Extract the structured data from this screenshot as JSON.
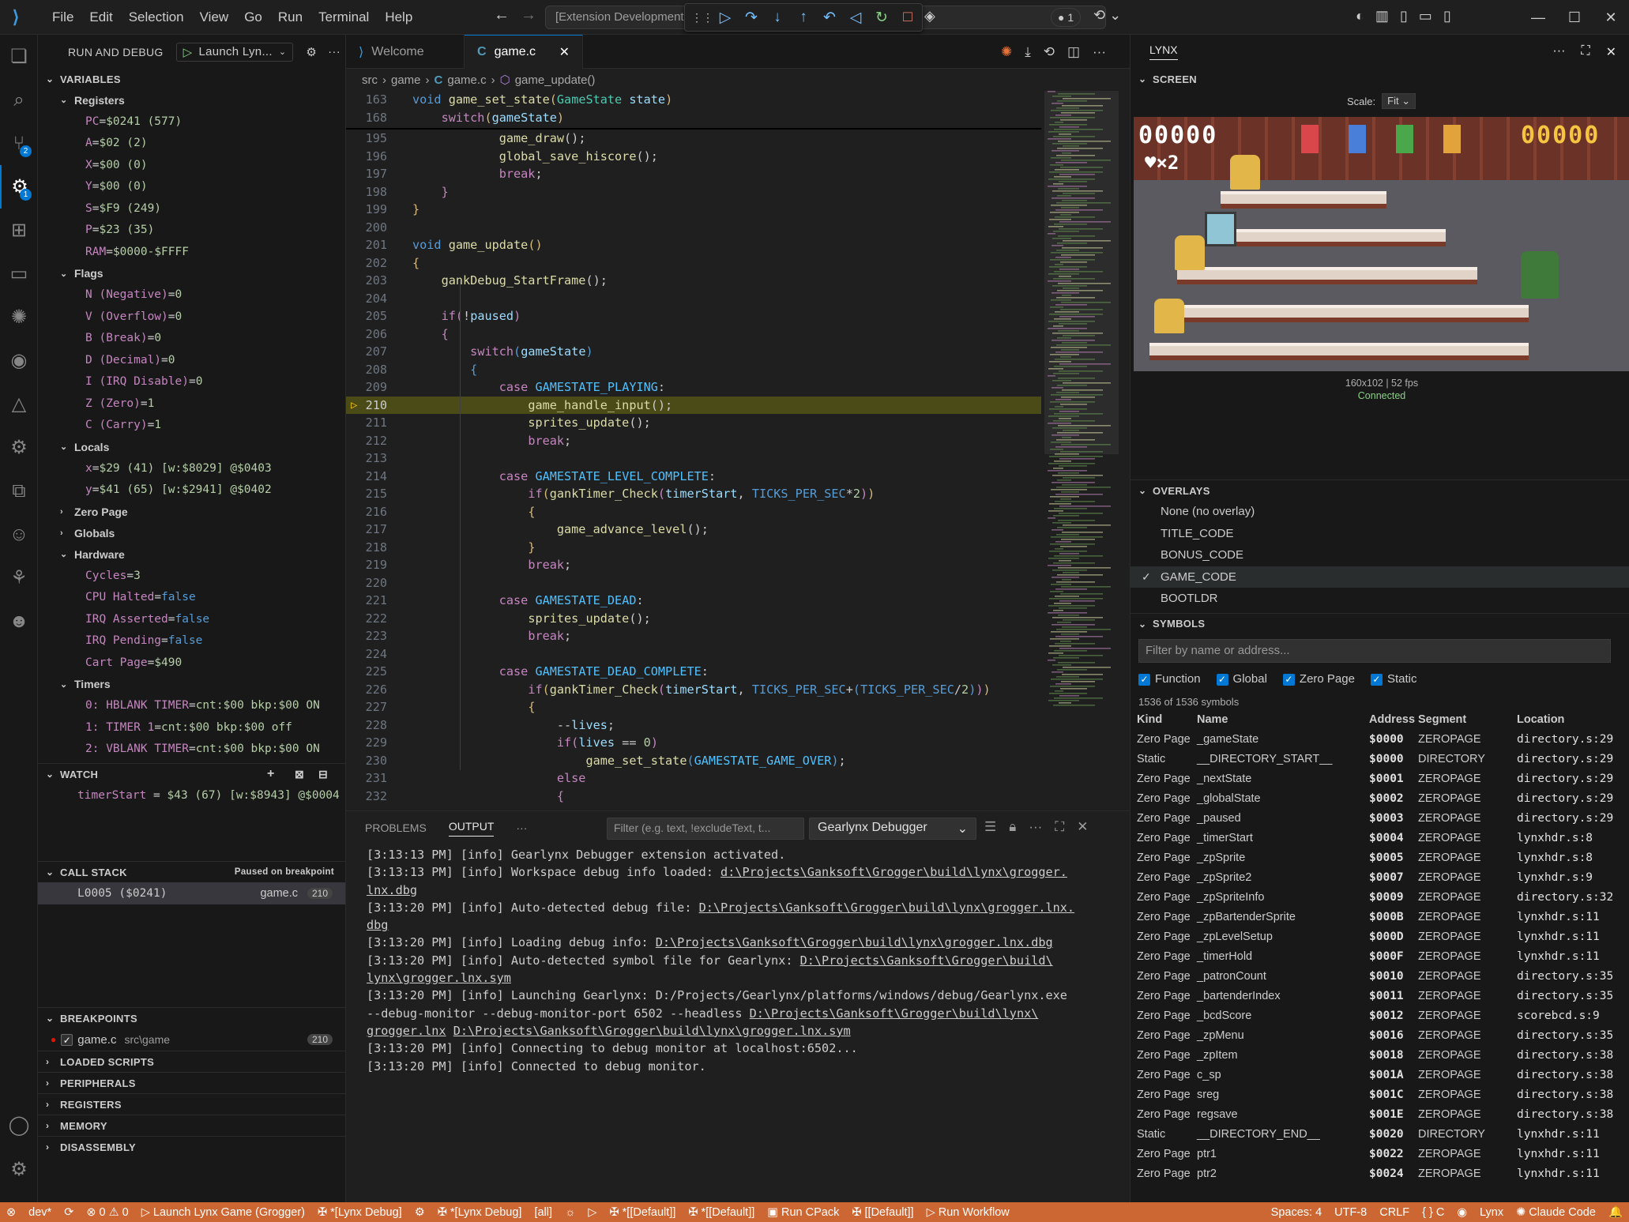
{
  "titlebar": {
    "menu": [
      "File",
      "Edit",
      "Selection",
      "View",
      "Go",
      "Run",
      "Terminal",
      "Help"
    ],
    "search": "[Extension Development",
    "debug_count": "1",
    "debug_actions": [
      "continue-icon",
      "step-over-icon",
      "step-into-icon",
      "step-out-icon",
      "step-back-icon",
      "reverse-continue-icon",
      "restart-icon",
      "stop-icon"
    ]
  },
  "activity": [
    {
      "name": "explorer-icon",
      "glyph": "❏"
    },
    {
      "name": "search-icon",
      "glyph": "⌕"
    },
    {
      "name": "source-control-icon",
      "glyph": "⑂",
      "badge": "2"
    },
    {
      "name": "run-debug-icon",
      "glyph": "⚙",
      "badge": "1"
    },
    {
      "name": "extensions-icon",
      "glyph": "⊞"
    },
    {
      "name": "remote-explorer-icon",
      "glyph": "▭"
    },
    {
      "name": "claude-icon",
      "glyph": "✺"
    },
    {
      "name": "github-icon",
      "glyph": "◉"
    },
    {
      "name": "azure-icon",
      "glyph": "△"
    },
    {
      "name": "remote-debug-icon",
      "glyph": "⚙"
    },
    {
      "name": "structure-icon",
      "glyph": "⧉"
    },
    {
      "name": "bot-icon",
      "glyph": "☺"
    },
    {
      "name": "tree-icon",
      "glyph": "⚘"
    },
    {
      "name": "alien-icon",
      "glyph": "☻"
    }
  ],
  "sidebar": {
    "title": "RUN AND DEBUG",
    "launch": "Launch Lyn...",
    "variables": "VARIABLES",
    "registers_title": "Registers",
    "registers": [
      {
        "n": "PC",
        "v": "$0241 (577)"
      },
      {
        "n": "A",
        "v": "$02 (2)"
      },
      {
        "n": "X",
        "v": "$00 (0)"
      },
      {
        "n": "Y",
        "v": "$00 (0)"
      },
      {
        "n": "S",
        "v": "$F9 (249)"
      },
      {
        "n": "P",
        "v": "$23 (35)"
      },
      {
        "n": "RAM",
        "v": "$0000-$FFFF"
      }
    ],
    "flags_title": "Flags",
    "flags": [
      {
        "n": "N (Negative)",
        "v": "0"
      },
      {
        "n": "V (Overflow)",
        "v": "0"
      },
      {
        "n": "B (Break)",
        "v": "0"
      },
      {
        "n": "D (Decimal)",
        "v": "0"
      },
      {
        "n": "I (IRQ Disable)",
        "v": "0"
      },
      {
        "n": "Z (Zero)",
        "v": "1"
      },
      {
        "n": "C (Carry)",
        "v": "1"
      }
    ],
    "locals_title": "Locals",
    "locals": [
      {
        "n": "x",
        "v": "$29 (41) [w:$8029] @$0403"
      },
      {
        "n": "y",
        "v": "$41 (65) [w:$2941] @$0402"
      }
    ],
    "zero_page": "Zero Page",
    "globals": "Globals",
    "hardware_title": "Hardware",
    "hardware": [
      {
        "n": "Cycles",
        "v": "3",
        "bool": false
      },
      {
        "n": "CPU Halted",
        "v": "false",
        "bool": true
      },
      {
        "n": "IRQ Asserted",
        "v": "false",
        "bool": true
      },
      {
        "n": "IRQ Pending",
        "v": "false",
        "bool": true
      },
      {
        "n": "Cart Page",
        "v": "$490",
        "bool": false
      }
    ],
    "timers_title": "Timers",
    "timers": [
      {
        "n": "0: HBLANK TIMER",
        "v": "cnt:$00 bkp:$00 ON"
      },
      {
        "n": "1: TIMER 1",
        "v": "cnt:$00 bkp:$00 off"
      },
      {
        "n": "2: VBLANK TIMER",
        "v": "cnt:$00 bkp:$00 ON"
      }
    ],
    "watch": "WATCH",
    "watch_expr": {
      "n": "timerStart",
      "v": "$43 (67) [w:$8943] @$0004"
    },
    "callstack": "CALL STACK",
    "paused": "Paused on breakpoint",
    "frame": {
      "name": "L0005 ($0241)",
      "file": "game.c",
      "line": "210"
    },
    "breakpoints": "BREAKPOINTS",
    "bp": {
      "file": "game.c",
      "path": "src\\game",
      "line": "210"
    },
    "collapsed": [
      "LOADED SCRIPTS",
      "PERIPHERALS",
      "REGISTERS",
      "MEMORY",
      "DISASSEMBLY"
    ]
  },
  "editor": {
    "tabs": [
      "Welcome",
      "game.c"
    ],
    "breadcrumb": [
      "src",
      "game",
      "game.c",
      "game_update()"
    ],
    "sticky": [
      {
        "ln": "163",
        "html": "<span class='kw'>void</span> <span class='fn'>game_set_state</span><span class='br'>(</span><span class='ty'>GameState</span> <span class='id'>state</span><span class='br'>)</span>"
      },
      {
        "ln": "168",
        "html": "    <span class='ctl'>switch</span><span class='br'>(</span><span class='id'>gameState</span><span class='br'>)</span>"
      }
    ],
    "lines": [
      {
        "ln": "195",
        "html": "            <span class='fn'>game_draw</span><span class='pl'>();</span>"
      },
      {
        "ln": "196",
        "html": "            <span class='fn'>global_save_hiscore</span><span class='pl'>();</span>"
      },
      {
        "ln": "197",
        "html": "            <span class='ctl'>break</span><span class='pl'>;</span>"
      },
      {
        "ln": "198",
        "html": "    <span class='ctl'>}</span>"
      },
      {
        "ln": "199",
        "html": "<span class='br'>}</span>"
      },
      {
        "ln": "200",
        "html": ""
      },
      {
        "ln": "201",
        "html": "<span class='kw'>void</span> <span class='fn'>game_update</span><span class='br'>()</span>"
      },
      {
        "ln": "202",
        "html": "<span class='br'>{</span>"
      },
      {
        "ln": "203",
        "html": "    <span class='fn'>gankDebug_StartFrame</span><span class='pl'>();</span>"
      },
      {
        "ln": "204",
        "html": ""
      },
      {
        "ln": "205",
        "html": "    <span class='ctl'>if</span><span class='ctl'>(</span><span class='pl'>!</span><span class='id'>paused</span><span class='ctl'>)</span>"
      },
      {
        "ln": "206",
        "html": "    <span class='ctl'>{</span>"
      },
      {
        "ln": "207",
        "html": "        <span class='ctl'>switch</span><span class='kw'>(</span><span class='id'>gameState</span><span class='kw'>)</span>"
      },
      {
        "ln": "208",
        "html": "        <span class='kw'>{</span>"
      },
      {
        "ln": "209",
        "html": "            <span class='ctl'>case</span> <span class='ct'>GAMESTATE_PLAYING</span><span class='pl'>:</span>"
      },
      {
        "ln": "210",
        "html": "                <span class='fn'>game_handle_input</span><span class='pl'>();</span>",
        "hl": true
      },
      {
        "ln": "211",
        "html": "                <span class='fn'>sprites_update</span><span class='pl'>();</span>"
      },
      {
        "ln": "212",
        "html": "                <span class='ctl'>break</span><span class='pl'>;</span>"
      },
      {
        "ln": "213",
        "html": ""
      },
      {
        "ln": "214",
        "html": "            <span class='ctl'>case</span> <span class='ct'>GAMESTATE_LEVEL_COMPLETE</span><span class='pl'>:</span>"
      },
      {
        "ln": "215",
        "html": "                <span class='ctl'>if</span><span class='br'>(</span><span class='fn'>gankTimer_Check</span><span class='ctl'>(</span><span class='id'>timerStart</span><span class='pl'>, </span><span class='mac'>TICKS_PER_SEC</span><span class='pl'>*</span><span class='nm'>2</span><span class='ctl'>)</span><span class='br'>)</span>"
      },
      {
        "ln": "216",
        "html": "                <span class='br'>{</span>"
      },
      {
        "ln": "217",
        "html": "                    <span class='fn'>game_advance_level</span><span class='pl'>();</span>"
      },
      {
        "ln": "218",
        "html": "                <span class='br'>}</span>"
      },
      {
        "ln": "219",
        "html": "                <span class='ctl'>break</span><span class='pl'>;</span>"
      },
      {
        "ln": "220",
        "html": ""
      },
      {
        "ln": "221",
        "html": "            <span class='ctl'>case</span> <span class='ct'>GAMESTATE_DEAD</span><span class='pl'>:</span>"
      },
      {
        "ln": "222",
        "html": "                <span class='fn'>sprites_update</span><span class='pl'>();</span>"
      },
      {
        "ln": "223",
        "html": "                <span class='ctl'>break</span><span class='pl'>;</span>"
      },
      {
        "ln": "224",
        "html": ""
      },
      {
        "ln": "225",
        "html": "            <span class='ctl'>case</span> <span class='ct'>GAMESTATE_DEAD_COMPLETE</span><span class='pl'>:</span>"
      },
      {
        "ln": "226",
        "html": "                <span class='ctl'>if</span><span class='br'>(</span><span class='fn'>gankTimer_Check</span><span class='ctl'>(</span><span class='id'>timerStart</span><span class='pl'>, </span><span class='mac'>TICKS_PER_SEC</span><span class='pl'>+</span><span class='kw'>(</span><span class='mac'>TICKS_PER_SEC</span><span class='pl'>/</span><span class='nm'>2</span><span class='kw'>)</span><span class='ctl'>)</span><span class='br'>)</span>"
      },
      {
        "ln": "227",
        "html": "                <span class='br'>{</span>"
      },
      {
        "ln": "228",
        "html": "                    <span class='pl'>--</span><span class='id'>lives</span><span class='pl'>;</span>"
      },
      {
        "ln": "229",
        "html": "                    <span class='ctl'>if</span><span class='ctl'>(</span><span class='id'>lives</span> <span class='pl'>==</span> <span class='nm'>0</span><span class='ctl'>)</span>"
      },
      {
        "ln": "230",
        "html": "                        <span class='fn'>game_set_state</span><span class='kw'>(</span><span class='ct'>GAMESTATE_GAME_OVER</span><span class='kw'>)</span><span class='pl'>;</span>"
      },
      {
        "ln": "231",
        "html": "                    <span class='ctl'>else</span>"
      },
      {
        "ln": "232",
        "html": "                    <span class='ctl'>{</span>"
      }
    ]
  },
  "panel": {
    "tabs": [
      "PROBLEMS",
      "OUTPUT"
    ],
    "filter_placeholder": "Filter (e.g. text, !excludeText, t...",
    "channel": "Gearlynx Debugger",
    "output_html": "[3:13:13 PM] [info] Gearlynx Debugger extension activated.<br>[3:13:13 PM] [info] Workspace debug info loaded: <span class='lk'>d:\\Projects\\Ganksoft\\Grogger\\build\\lynx\\grogger.<br>lnx.dbg</span><br>[3:13:20 PM] [info] Auto-detected debug file: <span class='lk'>D:\\Projects\\Ganksoft\\Grogger\\build\\lynx\\grogger.lnx.<br>dbg</span><br>[3:13:20 PM] [info] Loading debug info: <span class='lk'>D:\\Projects\\Ganksoft\\Grogger\\build\\lynx\\grogger.lnx.dbg</span><br>[3:13:20 PM] [info] Auto-detected symbol file for Gearlynx: <span class='lk'>D:\\Projects\\Ganksoft\\Grogger\\build\\<br>lynx\\grogger.lnx.sym</span><br>[3:13:20 PM] [info] Launching Gearlynx: D:/Projects/Gearlynx/platforms/windows/debug/Gearlynx.exe<br>--debug-monitor --debug-monitor-port 6502 --headless <span class='lk'>D:\\Projects\\Ganksoft\\Grogger\\build\\lynx\\</span><br><span class='lk'>grogger.lnx</span> <span class='lk'>D:\\Projects\\Ganksoft\\Grogger\\build\\lynx\\grogger.lnx.sym</span><br>[3:13:20 PM] [info] Connecting to debug monitor at localhost:6502...<br>[3:13:20 PM] [info] Connected to debug monitor."
  },
  "lynx": {
    "title": "LYNX",
    "screen": "SCREEN",
    "scale_label": "Scale:",
    "scale_value": "Fit",
    "score_left": "00000",
    "score_right": "00000",
    "lives": "♥×2",
    "info": "160x102 | 52 fps",
    "status": "Connected",
    "overlays_title": "OVERLAYS",
    "overlays": [
      {
        "label": "None (no overlay)",
        "checked": false
      },
      {
        "label": "TITLE_CODE",
        "checked": false
      },
      {
        "label": "BONUS_CODE",
        "checked": false
      },
      {
        "label": "GAME_CODE",
        "checked": true
      },
      {
        "label": "BOOTLDR",
        "checked": false
      }
    ],
    "symbols_title": "SYMBOLS",
    "sym_filter": "Filter by name or address...",
    "sym_checks": [
      "Function",
      "Global",
      "Zero Page",
      "Static"
    ],
    "sym_count": "1536 of 1536 symbols",
    "sym_cols": [
      "Kind",
      "Name",
      "Address",
      "Segment",
      "Location"
    ],
    "symbols": [
      [
        "Zero Page",
        "_gameState",
        "$0000",
        "ZEROPAGE",
        "directory.s:29"
      ],
      [
        "Static",
        "__DIRECTORY_START__",
        "$0000",
        "DIRECTORY",
        "directory.s:29"
      ],
      [
        "Zero Page",
        "_nextState",
        "$0001",
        "ZEROPAGE",
        "directory.s:29"
      ],
      [
        "Zero Page",
        "_globalState",
        "$0002",
        "ZEROPAGE",
        "directory.s:29"
      ],
      [
        "Zero Page",
        "_paused",
        "$0003",
        "ZEROPAGE",
        "directory.s:29"
      ],
      [
        "Zero Page",
        "_timerStart",
        "$0004",
        "ZEROPAGE",
        "lynxhdr.s:8"
      ],
      [
        "Zero Page",
        "_zpSprite",
        "$0005",
        "ZEROPAGE",
        "lynxhdr.s:8"
      ],
      [
        "Zero Page",
        "_zpSprite2",
        "$0007",
        "ZEROPAGE",
        "lynxhdr.s:9"
      ],
      [
        "Zero Page",
        "_zpSpriteInfo",
        "$0009",
        "ZEROPAGE",
        "directory.s:32"
      ],
      [
        "Zero Page",
        "_zpBartenderSprite",
        "$000B",
        "ZEROPAGE",
        "lynxhdr.s:11"
      ],
      [
        "Zero Page",
        "_zpLevelSetup",
        "$000D",
        "ZEROPAGE",
        "lynxhdr.s:11"
      ],
      [
        "Zero Page",
        "_timerHold",
        "$000F",
        "ZEROPAGE",
        "lynxhdr.s:11"
      ],
      [
        "Zero Page",
        "_patronCount",
        "$0010",
        "ZEROPAGE",
        "directory.s:35"
      ],
      [
        "Zero Page",
        "_bartenderIndex",
        "$0011",
        "ZEROPAGE",
        "directory.s:35"
      ],
      [
        "Zero Page",
        "_bcdScore",
        "$0012",
        "ZEROPAGE",
        "scorebcd.s:9"
      ],
      [
        "Zero Page",
        "_zpMenu",
        "$0016",
        "ZEROPAGE",
        "directory.s:35"
      ],
      [
        "Zero Page",
        "_zpItem",
        "$0018",
        "ZEROPAGE",
        "directory.s:38"
      ],
      [
        "Zero Page",
        "c_sp",
        "$001A",
        "ZEROPAGE",
        "directory.s:38"
      ],
      [
        "Zero Page",
        "sreg",
        "$001C",
        "ZEROPAGE",
        "directory.s:38"
      ],
      [
        "Zero Page",
        "regsave",
        "$001E",
        "ZEROPAGE",
        "directory.s:38"
      ],
      [
        "Static",
        "__DIRECTORY_END__",
        "$0020",
        "DIRECTORY",
        "lynxhdr.s:11"
      ],
      [
        "Zero Page",
        "ptr1",
        "$0022",
        "ZEROPAGE",
        "lynxhdr.s:11"
      ],
      [
        "Zero Page",
        "ptr2",
        "$0024",
        "ZEROPAGE",
        "lynxhdr.s:11"
      ]
    ]
  },
  "status": {
    "left": [
      "⊗",
      "dev*",
      "⟳",
      "⊗ 0 ⚠ 0",
      "▷ Launch Lynx Game (Grogger)",
      "✠ *[Lynx Debug]",
      "⚙",
      "✠ *[Lynx Debug]",
      "[all]",
      "☼",
      "▷",
      "✠ *[[Default]]",
      "✠ *[[Default]]",
      "▣ Run CPack",
      "✠ [[Default]]",
      "▷ Run Workflow"
    ],
    "right": [
      "Spaces: 4",
      "UTF-8",
      "CRLF",
      "{ } C",
      "◉",
      "Lynx",
      "✺ Claude Code",
      "🔔"
    ]
  },
  "colors": {
    "accent": "#0078d4",
    "status": "#cc6633",
    "highlight": "#4b4b18"
  }
}
